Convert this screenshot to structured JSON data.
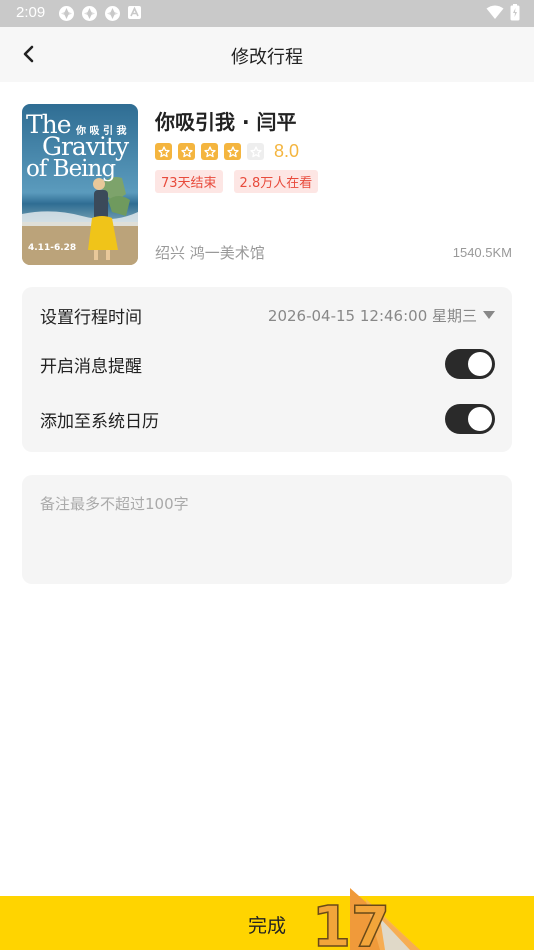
{
  "status_bar": {
    "time": "2:09"
  },
  "nav": {
    "title": "修改行程"
  },
  "event": {
    "title": "你吸引我 · 闫平",
    "rating": 8.0,
    "rating_text": "8.0",
    "stars_filled": 4,
    "stars_total": 5,
    "tags": [
      "73天结束",
      "2.8万人在看"
    ],
    "venue": "绍兴  鸿一美术馆",
    "distance": "1540.5KM",
    "poster": {
      "title_line1": "The",
      "title_cn": "你 吸 引 我",
      "title_line2": "Gravity",
      "title_line3": "of Being",
      "dates": "4.11-6.28"
    }
  },
  "settings": {
    "time_label": "设置行程时间",
    "time_value": "2026-04-15 12:46:00 星期三",
    "reminder_label": "开启消息提醒",
    "reminder_on": true,
    "calendar_label": "添加至系统日历",
    "calendar_on": true
  },
  "note": {
    "placeholder": "备注最多不超过100字",
    "value": ""
  },
  "footer": {
    "done_label": "完成",
    "badge_text": "17"
  },
  "colors": {
    "accent_yellow": "#ffd400",
    "star": "#f4b53f",
    "tag_bg": "#fde6e4",
    "tag_text": "#e84b3c"
  }
}
